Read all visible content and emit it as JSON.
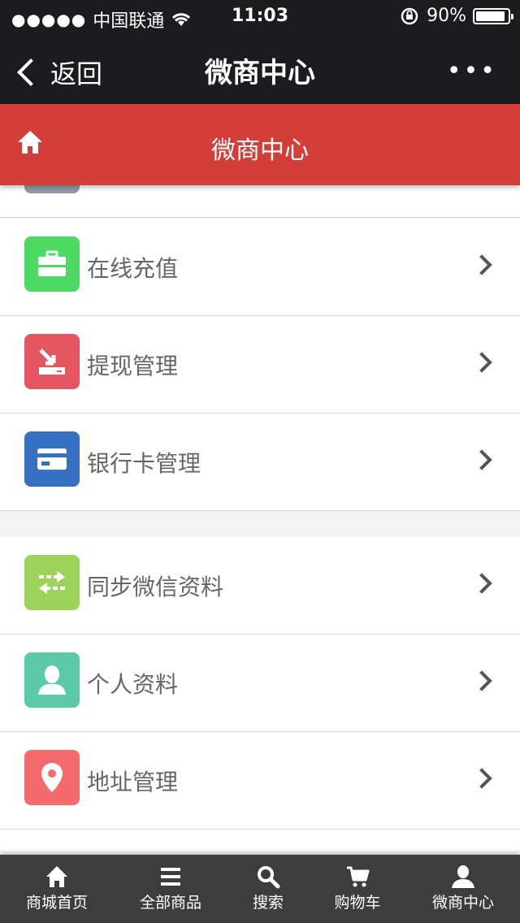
{
  "status_bar": {
    "signal": "●●●●●",
    "carrier": "中国联通",
    "time": "11:03",
    "battery": "90%"
  },
  "nav": {
    "back_label": "返回",
    "title": "微商中心",
    "more": "•••"
  },
  "header": {
    "title": "微商中心",
    "color": "#d33e38"
  },
  "menu_items": [
    {
      "label": "在线充值",
      "icon": "wallet-icon",
      "color": "#4cd964"
    },
    {
      "label": "提现管理",
      "icon": "withdraw-icon",
      "color": "#e55461"
    },
    {
      "label": "银行卡管理",
      "icon": "bank-card-icon",
      "color": "#3670c0"
    },
    {
      "label": "同步微信资料",
      "icon": "sync-icon",
      "color": "#9ed35b"
    },
    {
      "label": "个人资料",
      "icon": "user-icon",
      "color": "#5cc9a8"
    },
    {
      "label": "地址管理",
      "icon": "location-pin-icon",
      "color": "#f56a6a"
    }
  ],
  "tabs": [
    {
      "label": "商城首页",
      "icon": "home-icon"
    },
    {
      "label": "全部商品",
      "icon": "list-icon"
    },
    {
      "label": "搜索",
      "icon": "search-icon"
    },
    {
      "label": "购物车",
      "icon": "cart-icon"
    },
    {
      "label": "微商中心",
      "icon": "user-icon"
    }
  ]
}
